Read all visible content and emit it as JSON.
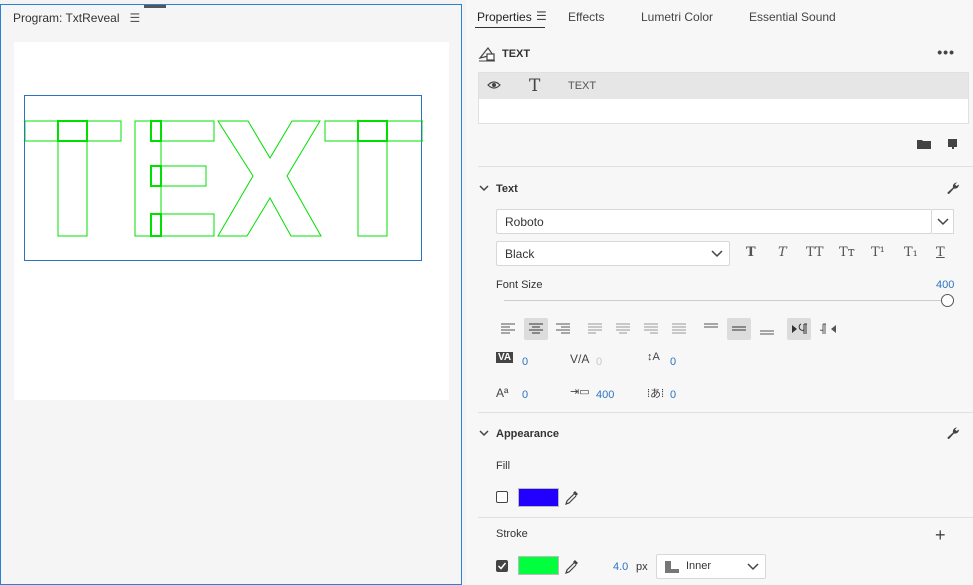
{
  "program": {
    "title": "Program: TxtReveal",
    "preview_text": "TEXT",
    "outline_color": "#00e000"
  },
  "tabs": [
    "Properties",
    "Effects",
    "Lumetri Color",
    "Essential Sound"
  ],
  "layer": {
    "title": "TEXT",
    "name": "TEXT",
    "icon": "T"
  },
  "text_section": {
    "title": "Text",
    "font_family": "Roboto",
    "font_style": "Black",
    "font_size_label": "Font Size",
    "font_size": "400",
    "font_size_fraction": 1.0,
    "type_buttons": [
      "T",
      "T",
      "TT",
      "Tт",
      "T¹",
      "T₁",
      "T"
    ],
    "alignment_selected": "center",
    "tracking": "0",
    "kerning": "0",
    "leading": "0",
    "baseline_shift": "0",
    "tab_width": "400",
    "tsume": "0"
  },
  "appearance": {
    "title": "Appearance",
    "fill_label": "Fill",
    "fill_enabled": false,
    "fill_color": "#2200ff",
    "stroke_label": "Stroke",
    "stroke_enabled": true,
    "stroke_color": "#00ff3c",
    "stroke_width": "4.0",
    "stroke_unit": "px",
    "stroke_position": "Inner"
  }
}
